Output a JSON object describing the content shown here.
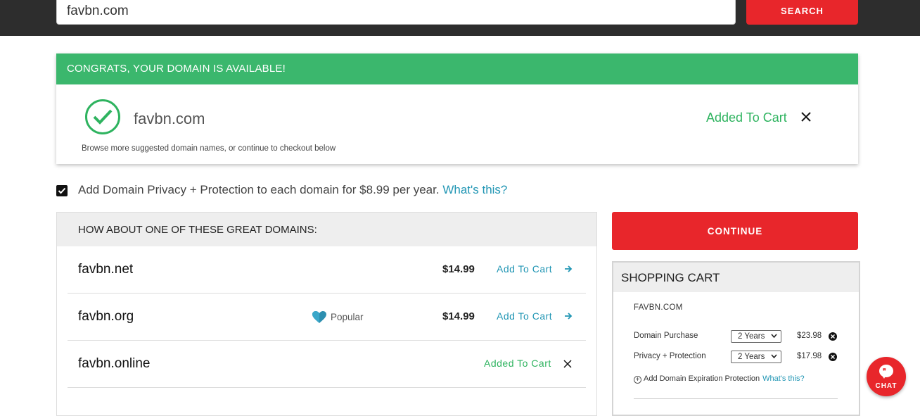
{
  "search": {
    "value": "favbn.com",
    "button_label": "SEARCH"
  },
  "availability": {
    "banner": "CONGRATS, YOUR DOMAIN IS AVAILABLE!",
    "domain": "favbn.com",
    "subtext": "Browse more suggested domain names, or continue to checkout below",
    "status": "Added To Cart"
  },
  "privacy": {
    "checked": true,
    "text": "Add Domain Privacy + Protection to each domain for $8.99 per year.",
    "link": "What's this?"
  },
  "suggestions": {
    "heading": "HOW ABOUT ONE OF THESE GREAT DOMAINS:",
    "items": [
      {
        "name": "favbn.net",
        "price": "$14.99",
        "action": "Add To Cart",
        "badge": ""
      },
      {
        "name": "favbn.org",
        "price": "$14.99",
        "action": "Add To Cart",
        "badge": "Popular"
      },
      {
        "name": "favbn.online",
        "price": "",
        "action": "Added To Cart",
        "badge": ""
      }
    ]
  },
  "continue_label": "CONTINUE",
  "cart": {
    "title": "SHOPPING CART",
    "domain": "FAVBN.COM",
    "lines": [
      {
        "label": "Domain Purchase",
        "term": "2 Years",
        "price": "$23.98"
      },
      {
        "label": "Privacy + Protection",
        "term": "2 Years",
        "price": "$17.98"
      }
    ],
    "expiration_text": "Add Domain Expiration Protection",
    "expiration_link": "What's this?"
  },
  "chat": {
    "label": "CHAT"
  },
  "colors": {
    "brand_red": "#e8262b",
    "success_green": "#3bb76d",
    "link_blue": "#2196b4"
  }
}
